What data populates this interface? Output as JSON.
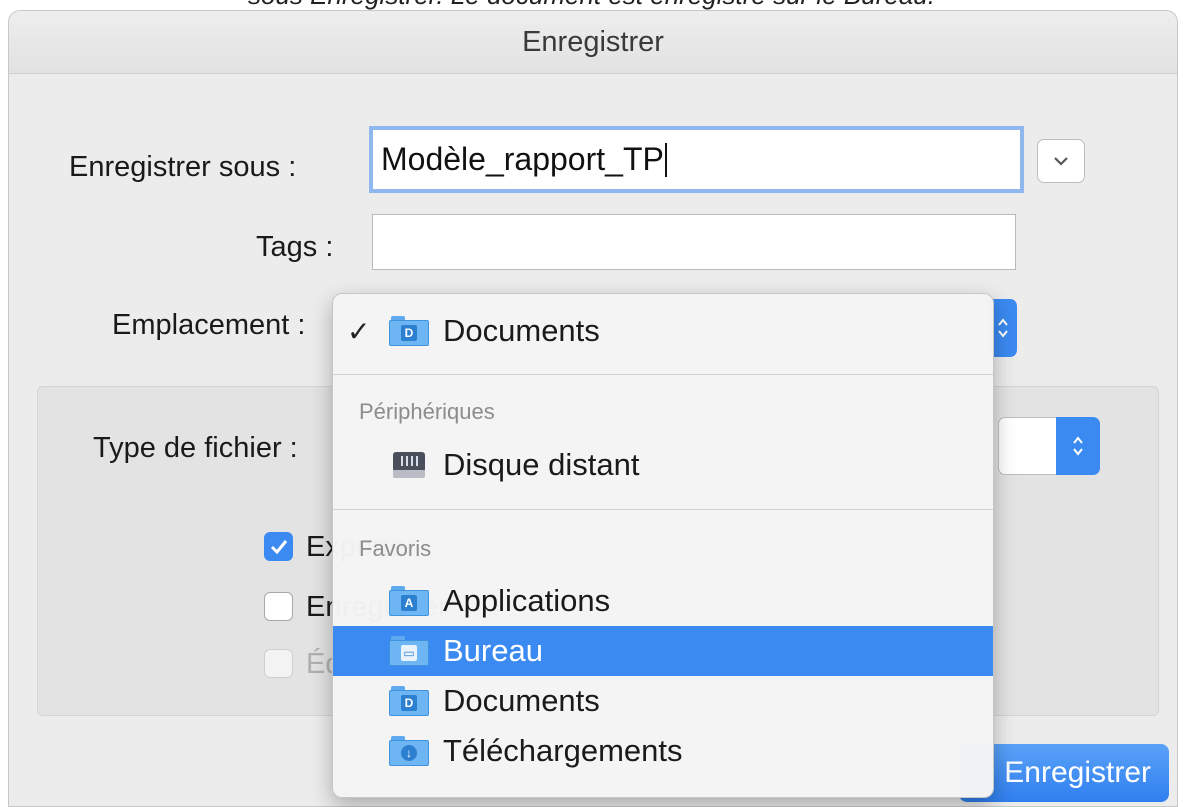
{
  "caption": "sous Enregistrer. Le document est enregistré sur le Bureau.",
  "dialog": {
    "title": "Enregistrer",
    "save_as_label": "Enregistrer sous :",
    "save_as_value": "Modèle_rapport_TP",
    "tags_label": "Tags :",
    "tags_value": "",
    "location_label": "Emplacement :",
    "file_type_label": "Type de fichier :",
    "expand_button_icon": "chevron-down-icon",
    "save_button_label": "Enregistrer"
  },
  "options": [
    {
      "label": "Exporter",
      "checked": true,
      "disabled": false
    },
    {
      "label": "Enregistrer",
      "checked": false,
      "disabled": false
    },
    {
      "label": "Éditer",
      "checked": false,
      "disabled": true
    }
  ],
  "menu": {
    "current": {
      "label": "Documents",
      "checked": true,
      "icon": "documents-folder-icon"
    },
    "sections": [
      {
        "title": "Périphériques",
        "items": [
          {
            "label": "Disque distant",
            "icon": "remote-disk-icon",
            "selected": false
          }
        ]
      },
      {
        "title": "Favoris",
        "items": [
          {
            "label": "Applications",
            "icon": "applications-folder-icon",
            "selected": false
          },
          {
            "label": "Bureau",
            "icon": "desktop-folder-icon",
            "selected": true
          },
          {
            "label": "Documents",
            "icon": "documents-folder-icon",
            "selected": false
          },
          {
            "label": "Téléchargements",
            "icon": "downloads-folder-icon",
            "selected": false
          }
        ]
      }
    ]
  },
  "colors": {
    "accent": "#3b8af2",
    "dialog_bg": "#ececec",
    "folder_blue": "#6db6f3"
  }
}
